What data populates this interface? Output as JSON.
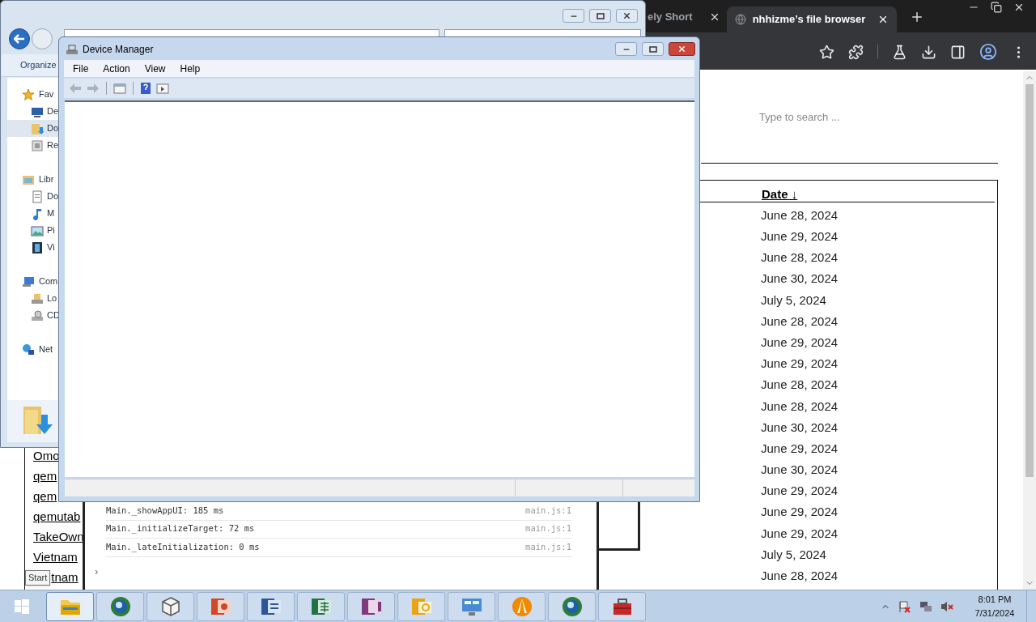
{
  "browser": {
    "tabs": [
      {
        "title": "ely Short",
        "selected": false
      },
      {
        "title": "nhhizme’s file browser",
        "selected": true
      }
    ],
    "search": {
      "placeholder": "Type to search ..."
    },
    "table": {
      "header": "Date ↓",
      "dates": [
        "June 28, 2024",
        "June 29, 2024",
        "June 28, 2024",
        "June 30, 2024",
        "July 5, 2024",
        "June 28, 2024",
        "June 29, 2024",
        "June 29, 2024",
        "June 28, 2024",
        "June 28, 2024",
        "June 30, 2024",
        "June 29, 2024",
        "June 30, 2024",
        "June 29, 2024",
        "June 29, 2024",
        "June 29, 2024",
        "July 5, 2024",
        "June 28, 2024"
      ]
    },
    "links": [
      "Omo",
      "qem",
      "qem",
      "qemutab",
      "TakeOwn",
      "Vietnam",
      "tnam"
    ],
    "console": {
      "lines": [
        {
          "text": "Main._showAppUI: 185 ms",
          "source": "main.js:1"
        },
        {
          "text": "Main._initializeTarget: 72 ms",
          "source": "main.js:1"
        },
        {
          "text": "Main._lateInitialization: 0 ms",
          "source": "main.js:1"
        }
      ],
      "prompt": "›"
    }
  },
  "explorer": {
    "toolbar": "Organize",
    "nav": [
      {
        "label": "Fav",
        "kind": "favorites",
        "selected": false,
        "children": [
          {
            "label": "De",
            "kind": "desktop",
            "selected": false
          },
          {
            "label": "Do",
            "kind": "downloads",
            "selected": true
          },
          {
            "label": "Re",
            "kind": "recent",
            "selected": false
          }
        ]
      },
      {
        "label": "Libr",
        "kind": "library",
        "selected": false,
        "children": [
          {
            "label": "Do",
            "kind": "documents",
            "selected": false
          },
          {
            "label": "M",
            "kind": "music",
            "selected": false
          },
          {
            "label": "Pi",
            "kind": "pictures",
            "selected": false
          },
          {
            "label": "Vi",
            "kind": "videos",
            "selected": false
          }
        ]
      },
      {
        "label": "Com",
        "kind": "computer",
        "selected": false,
        "children": [
          {
            "label": "Lo",
            "kind": "disk",
            "selected": false
          },
          {
            "label": "CD",
            "kind": "cd",
            "selected": false
          }
        ]
      },
      {
        "label": "Net",
        "kind": "network",
        "selected": false
      }
    ]
  },
  "device_manager": {
    "title": "Device Manager",
    "menu": [
      "File",
      "Action",
      "View",
      "Help"
    ]
  },
  "taskbar": {
    "tooltip": "Start",
    "apps": [
      {
        "kind": "folder",
        "selected": true
      },
      {
        "kind": "globe",
        "selected": false
      },
      {
        "kind": "cube",
        "selected": false
      },
      {
        "kind": "slides",
        "selected": false
      },
      {
        "kind": "document",
        "selected": false
      },
      {
        "kind": "spreadsheet",
        "selected": false
      },
      {
        "kind": "notebook",
        "selected": false
      },
      {
        "kind": "mail",
        "selected": false
      },
      {
        "kind": "panel",
        "selected": false
      },
      {
        "kind": "cone",
        "selected": false
      },
      {
        "kind": "globe",
        "selected": false
      },
      {
        "kind": "toolbox",
        "selected": false
      }
    ],
    "time": "8:01 PM",
    "date": "7/31/2024"
  }
}
